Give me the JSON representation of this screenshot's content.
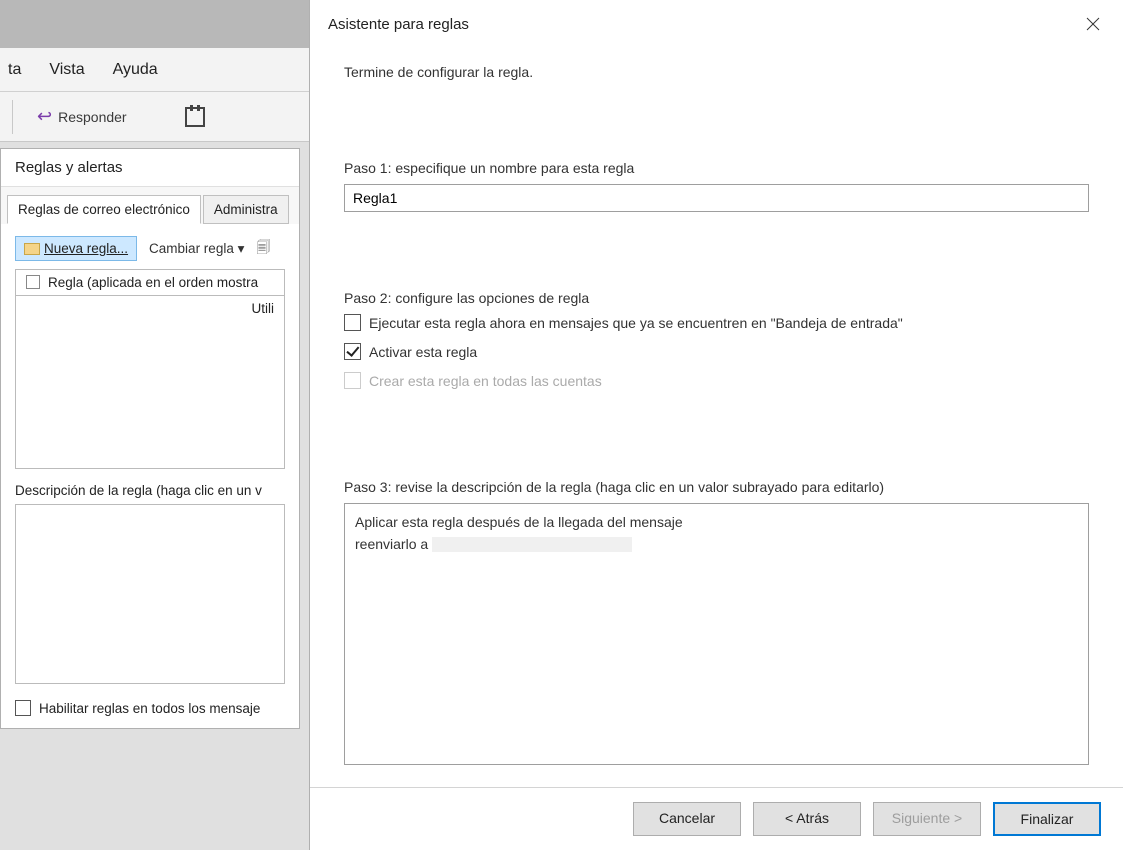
{
  "background": {
    "tabs": {
      "ta": "ta",
      "vista": "Vista",
      "ayuda": "Ayuda"
    },
    "toolbar": {
      "responder": "Responder"
    },
    "rules_dialog": {
      "title": "Reglas y alertas",
      "tab_email": "Reglas de correo electrónico",
      "tab_admin": "Administra",
      "new_rule": "Nueva regla...",
      "change_rule": "Cambiar regla",
      "list_header": "Regla (aplicada en el orden mostra",
      "list_body": "Utili",
      "desc_label": "Descripción de la regla (haga clic en un v",
      "enable_label": "Habilitar reglas en todos los mensaje"
    }
  },
  "wizard": {
    "title": "Asistente para reglas",
    "intro": "Termine de configurar la regla.",
    "step1": {
      "label": "Paso 1: especifique un nombre para esta regla",
      "value": "Regla1"
    },
    "step2": {
      "label": "Paso 2: configure las opciones de regla",
      "opt1": "Ejecutar esta regla ahora en mensajes que ya se encuentren en \"Bandeja de entrada\"",
      "opt2": "Activar esta regla",
      "opt3": "Crear esta regla en todas las cuentas",
      "opt1_checked": false,
      "opt2_checked": true,
      "opt3_checked": false,
      "opt3_disabled": true
    },
    "step3": {
      "label": "Paso 3: revise la descripción de la regla (haga clic en un valor subrayado para editarlo)",
      "line1": "Aplicar esta regla después de la llegada del mensaje",
      "line2_prefix": "reenviarlo a "
    },
    "buttons": {
      "cancel": "Cancelar",
      "back": "< Atrás",
      "next": "Siguiente >",
      "finish": "Finalizar"
    }
  }
}
